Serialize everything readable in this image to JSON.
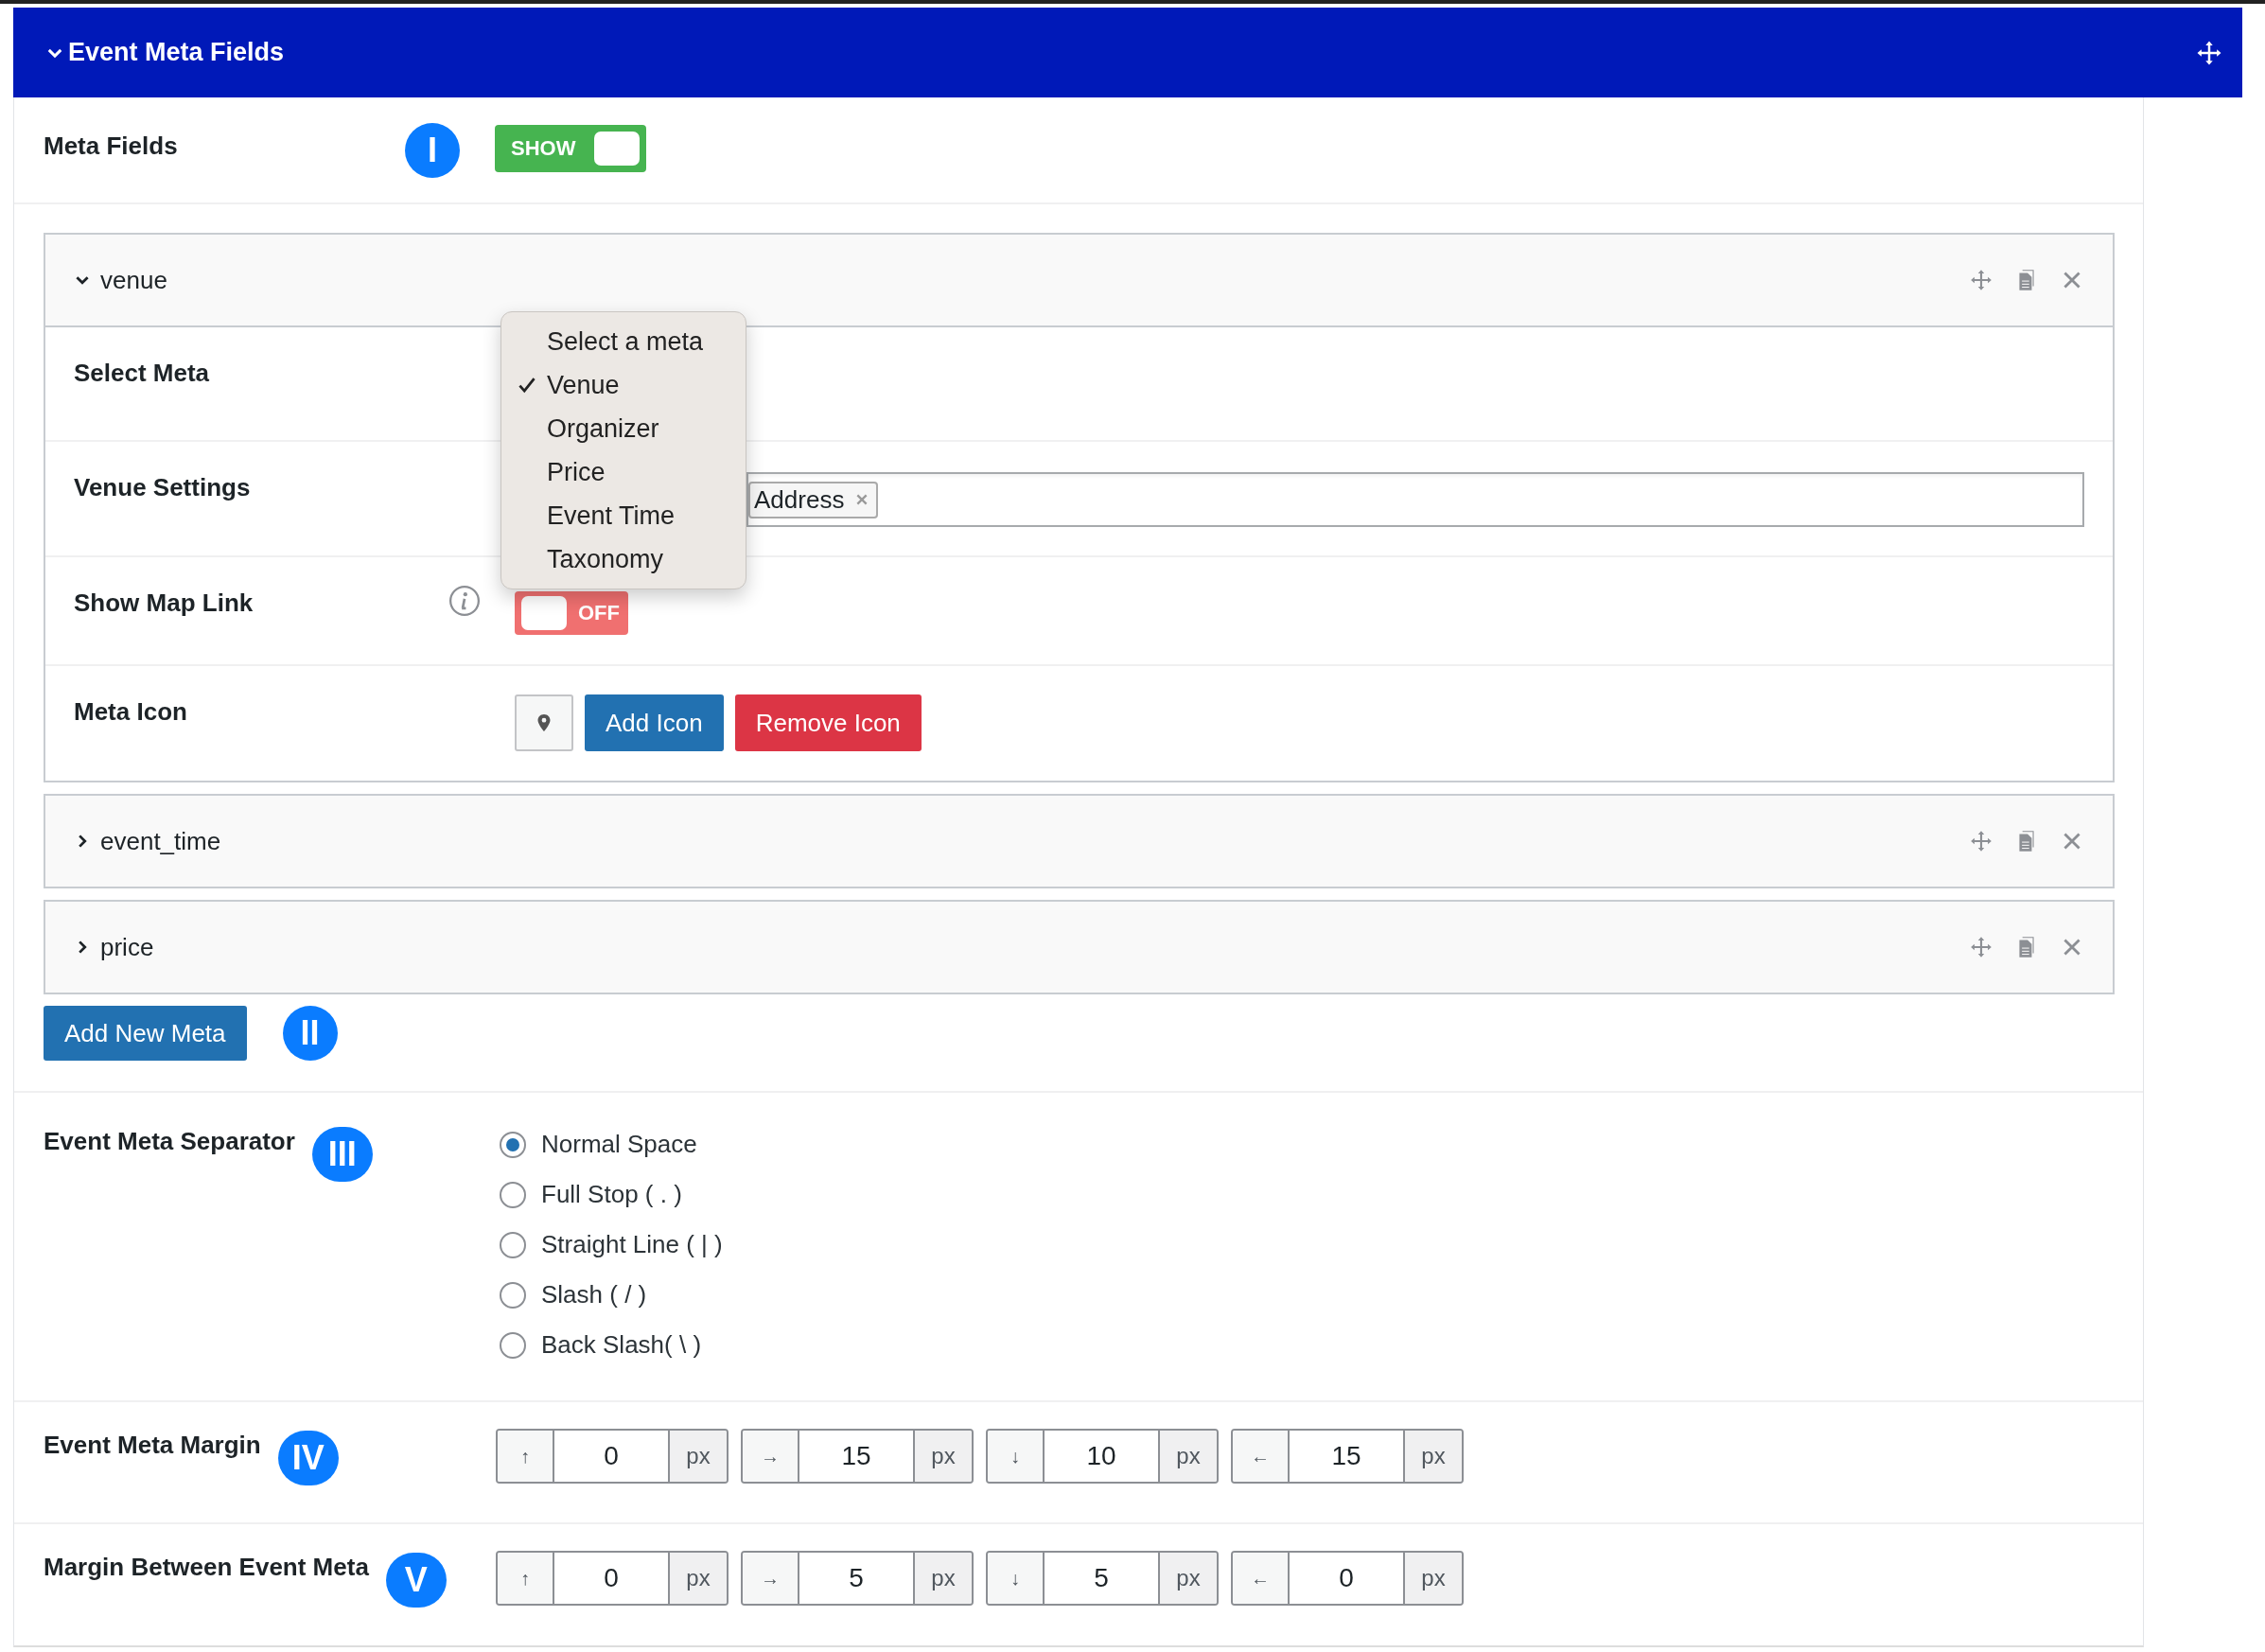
{
  "panel": {
    "title": "Event Meta Fields",
    "expanded": true
  },
  "meta_fields": {
    "label": "Meta Fields",
    "badge": "I",
    "toggle": {
      "label": "SHOW",
      "on": true
    }
  },
  "metas": [
    {
      "name": "venue",
      "expanded": true,
      "rows": [
        {
          "kind": "select",
          "label": "Select Meta",
          "options": [
            {
              "label": "Select a meta",
              "selected": false
            },
            {
              "label": "Venue",
              "selected": true
            },
            {
              "label": "Organizer",
              "selected": false
            },
            {
              "label": "Price",
              "selected": false
            },
            {
              "label": "Event Time",
              "selected": false
            },
            {
              "label": "Taxonomy",
              "selected": false
            }
          ]
        },
        {
          "kind": "tags",
          "label": "Venue Settings",
          "tags": [
            "Address"
          ]
        },
        {
          "kind": "toggle",
          "label": "Show Map Link",
          "info": true,
          "toggle": {
            "label": "OFF",
            "on": false
          }
        },
        {
          "kind": "icon",
          "label": "Meta Icon",
          "buttons": [
            {
              "label": "Add Icon",
              "kind": "primary"
            },
            {
              "label": "Remove Icon",
              "kind": "danger"
            }
          ]
        }
      ]
    },
    {
      "name": "event_time",
      "expanded": false
    },
    {
      "name": "price",
      "expanded": false
    }
  ],
  "add_button": {
    "label": "Add New Meta",
    "badge": "II"
  },
  "separator": {
    "label": "Event Meta Separator",
    "badge": "III",
    "options": [
      {
        "label": "Normal Space",
        "selected": true
      },
      {
        "label": "Full Stop ( . )",
        "selected": false
      },
      {
        "label": "Straight Line ( | )",
        "selected": false
      },
      {
        "label": "Slash ( / )",
        "selected": false
      },
      {
        "label": "Back Slash( \\ )",
        "selected": false
      }
    ]
  },
  "margins": [
    {
      "label": "Event Meta Margin",
      "badge": "IV",
      "fields": [
        {
          "arrow": "↑",
          "value": "0",
          "unit": "px"
        },
        {
          "arrow": "→",
          "value": "15",
          "unit": "px"
        },
        {
          "arrow": "↓",
          "value": "10",
          "unit": "px"
        },
        {
          "arrow": "←",
          "value": "15",
          "unit": "px"
        }
      ]
    },
    {
      "label": "Margin Between Event Meta",
      "badge": "V",
      "fields": [
        {
          "arrow": "↑",
          "value": "0",
          "unit": "px"
        },
        {
          "arrow": "→",
          "value": "5",
          "unit": "px"
        },
        {
          "arrow": "↓",
          "value": "5",
          "unit": "px"
        },
        {
          "arrow": "←",
          "value": "0",
          "unit": "px"
        }
      ]
    }
  ]
}
